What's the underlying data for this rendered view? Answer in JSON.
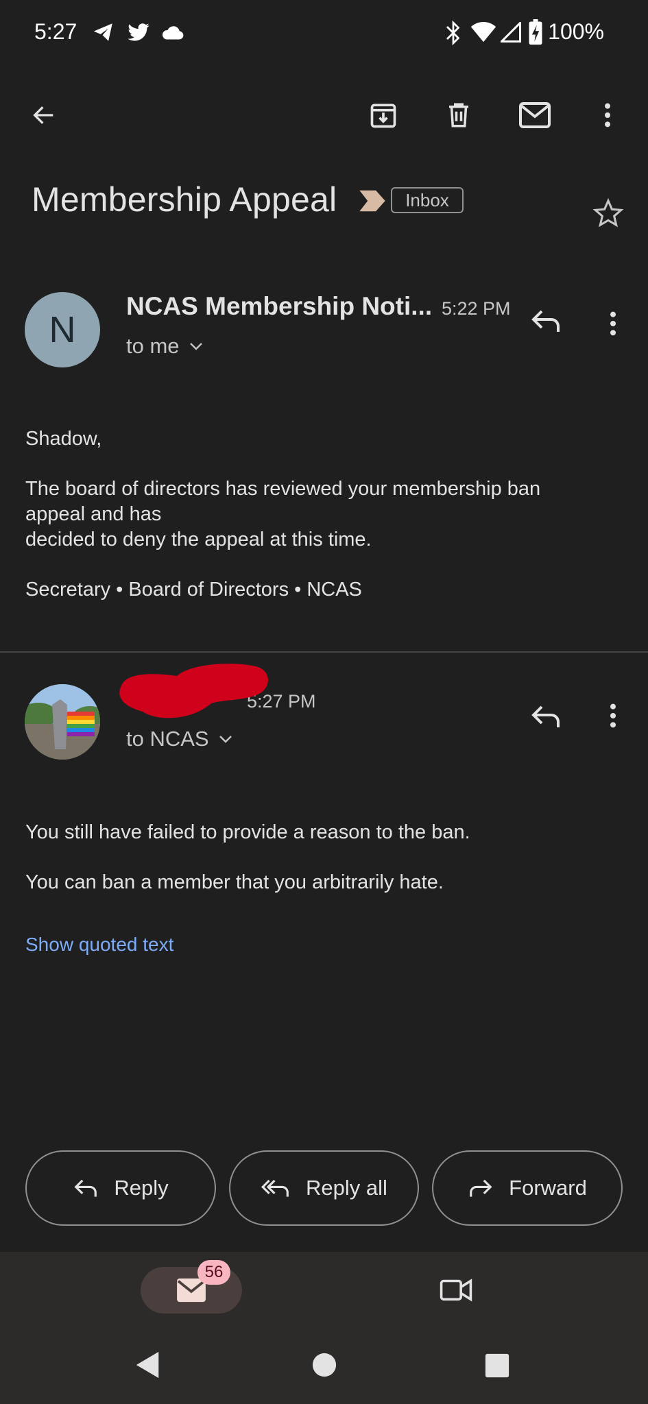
{
  "status_bar": {
    "time": "5:27",
    "battery_percent": "100%",
    "left_icons": [
      "telegram-icon",
      "twitter-icon",
      "cloud-icon"
    ],
    "right_icons": [
      "bluetooth-icon",
      "wifi-icon",
      "signal-icon",
      "battery-charging-icon"
    ]
  },
  "toolbar": {
    "icons": [
      "back-arrow-icon",
      "archive-icon",
      "delete-icon",
      "mark-unread-icon",
      "more-vert-icon"
    ]
  },
  "subject": {
    "title": "Membership Appeal",
    "label": "Inbox",
    "importance_marker_color": "#d7bba5"
  },
  "messages": [
    {
      "avatar_letter": "N",
      "avatar_color": "#8fa5b2",
      "sender": "NCAS Membership Noti...",
      "time": "5:22 PM",
      "recipient": "to me",
      "body": [
        "Shadow,",
        "The board of directors has reviewed your membership ban",
        "appeal and has",
        "decided to deny the appeal at this time.",
        "Secretary • Board of Directors • NCAS"
      ]
    },
    {
      "time": "5:27 PM",
      "recipient": "to NCAS",
      "redaction_color": "#d0011b",
      "body": [
        "You still have failed to provide a reason to the ban.",
        "You can ban a member that you arbitrarily hate."
      ],
      "quoted_link": "Show quoted text"
    }
  ],
  "actions": {
    "reply": "Reply",
    "reply_all": "Reply all",
    "forward": "Forward"
  },
  "bottom_nav": {
    "mail_badge": "56"
  },
  "colors": {
    "background": "#1f1f1f",
    "link": "#7cacf8",
    "nav_background": "#2d2a2a"
  }
}
